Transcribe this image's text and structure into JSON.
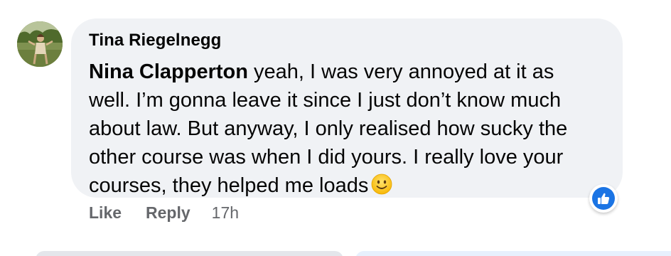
{
  "comment": {
    "author": "Tina Riegelnegg",
    "mention": "Nina Clapperton",
    "text": " yeah, I was very annoyed at it as well. I’m gonna leave it since I just don’t know much about law. But anyway, I only realised how sucky the other course was when I did yours. I really love your courses, they helped me loads",
    "emoji": "slightly-smiling-face-emoji",
    "reaction": "like-icon"
  },
  "actions": {
    "like_label": "Like",
    "reply_label": "Reply",
    "timestamp": "17h"
  },
  "colors": {
    "bubble": "#f0f2f5",
    "secondary_text": "#65676b",
    "like_blue": "#1b74e4"
  }
}
